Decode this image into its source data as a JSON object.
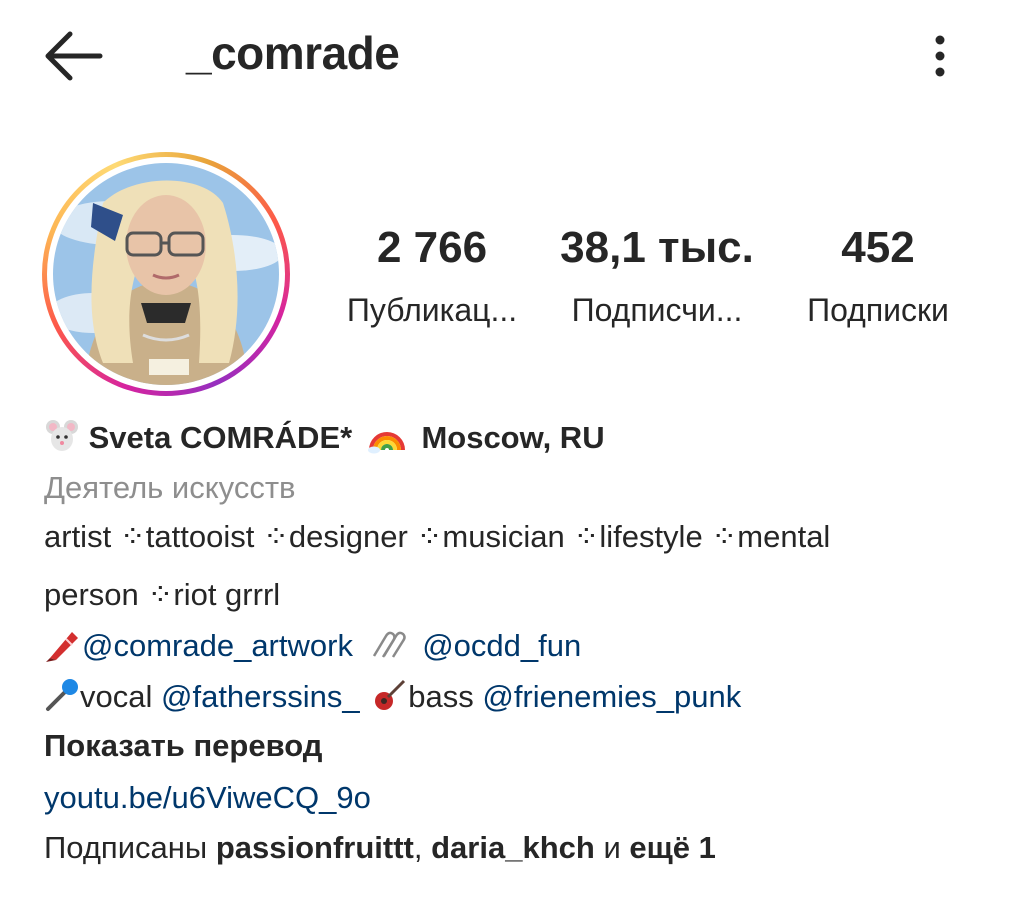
{
  "header": {
    "back_icon": "arrow-left-icon",
    "username": "_comrade",
    "more_icon": "more-vertical-icon"
  },
  "avatar": {
    "description_icon": "profile-photo",
    "ring_colors": [
      "#d6249f",
      "#fd5949",
      "#fdb654",
      "#962fbf"
    ]
  },
  "stats": {
    "posts": {
      "value": "2 766",
      "label": "Публикац..."
    },
    "followers": {
      "value": "38,1 тыс.",
      "label": "Подписчи..."
    },
    "following": {
      "value": "452",
      "label": "Подписки"
    }
  },
  "bio": {
    "name_icon": "mouse-emoji-icon",
    "name": "Sveta COMRÁDE*",
    "rainbow_icon": "rainbow-emoji-icon",
    "location": "Moscow, RU",
    "category": "Деятель искусств",
    "line1": "artist ⁘tattooist ⁘designer ⁘musician ⁘lifestyle ⁘mental",
    "line2": "person ⁘riot grrrl",
    "crayon_icon": "crayon-emoji-icon",
    "mention_artwork": "@comrade_artwork",
    "paperclip_icon": "paperclip-emoji-icon",
    "mention_ocdd": "@ocdd_fun",
    "mic_icon": "microphone-emoji-icon",
    "vocal_label": "vocal",
    "mention_fathers": "@fatherssins_",
    "guitar_icon": "guitar-emoji-icon",
    "bass_label": "bass",
    "mention_frienemies": "@frienemies_punk",
    "translate_label": "Показать перевод",
    "link": "youtu.be/u6ViweCQ_9o",
    "followed_prefix": "Подписаны",
    "followed_user1": "passionfruittt",
    "followed_sep": ",",
    "followed_user2": "daria_khch",
    "followed_and": "и",
    "followed_more": "ещё 1"
  },
  "colors": {
    "text": "#262626",
    "secondary": "#8e8e8e",
    "link": "#00376b"
  }
}
